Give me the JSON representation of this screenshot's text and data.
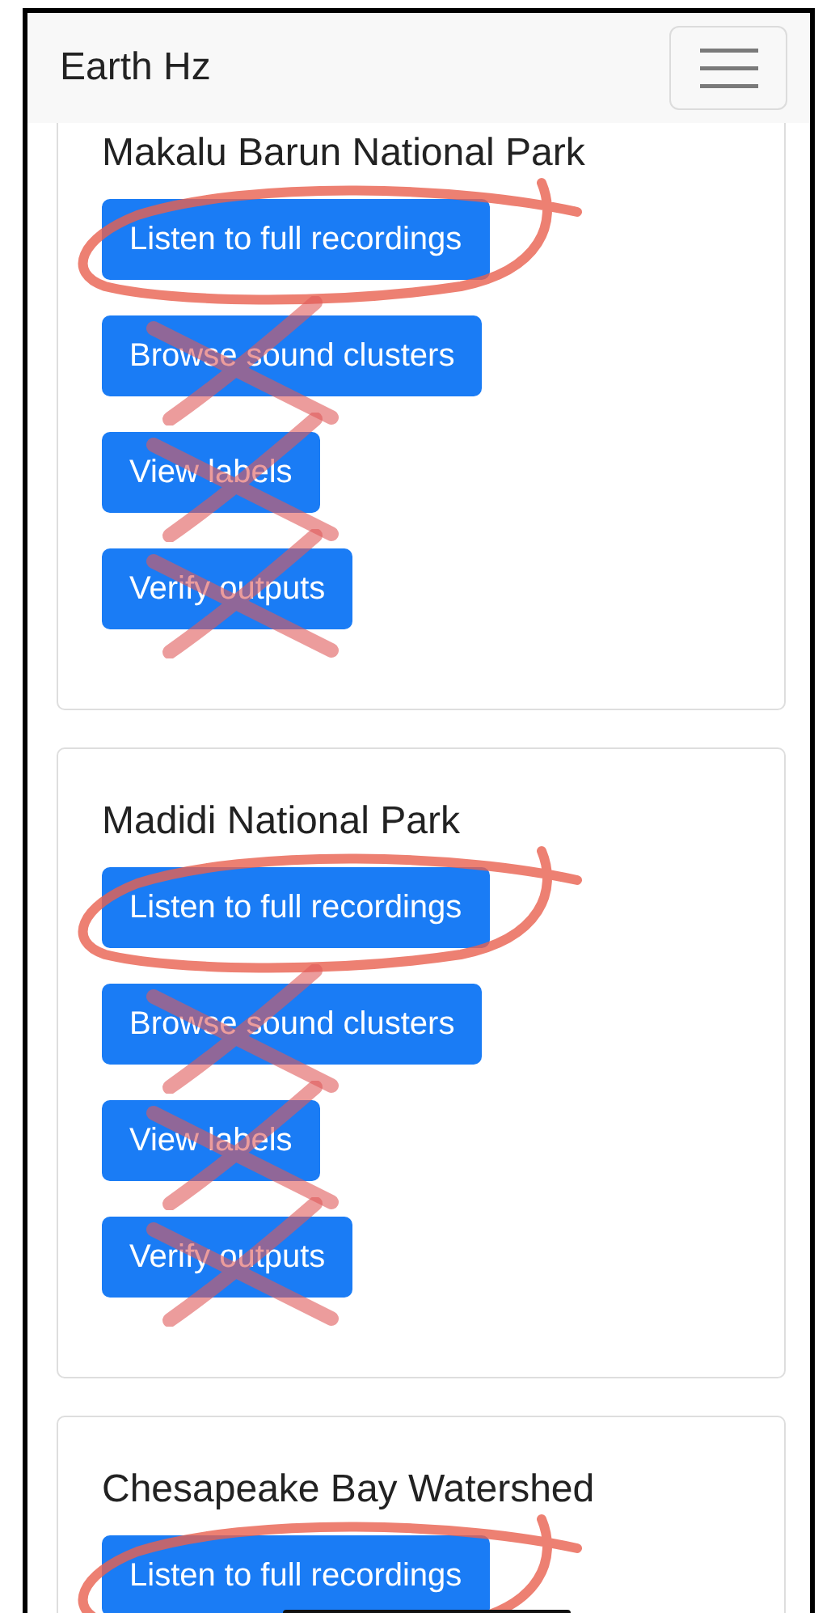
{
  "navbar": {
    "brand": "Earth Hz"
  },
  "cards": [
    {
      "title": "Makalu Barun National Park",
      "buttons": [
        {
          "label": "Listen to full recordings",
          "kind": "circled"
        },
        {
          "label": "Browse sound clusters",
          "kind": "crossed"
        },
        {
          "label": "View labels",
          "kind": "crossed"
        },
        {
          "label": "Verify outputs",
          "kind": "crossed"
        }
      ]
    },
    {
      "title": "Madidi National Park",
      "buttons": [
        {
          "label": "Listen to full recordings",
          "kind": "circled"
        },
        {
          "label": "Browse sound clusters",
          "kind": "crossed"
        },
        {
          "label": "View labels",
          "kind": "crossed"
        },
        {
          "label": "Verify outputs",
          "kind": "crossed"
        }
      ]
    },
    {
      "title": "Chesapeake Bay Watershed",
      "buttons": [
        {
          "label": "Listen to full recordings",
          "kind": "circled"
        }
      ]
    }
  ]
}
